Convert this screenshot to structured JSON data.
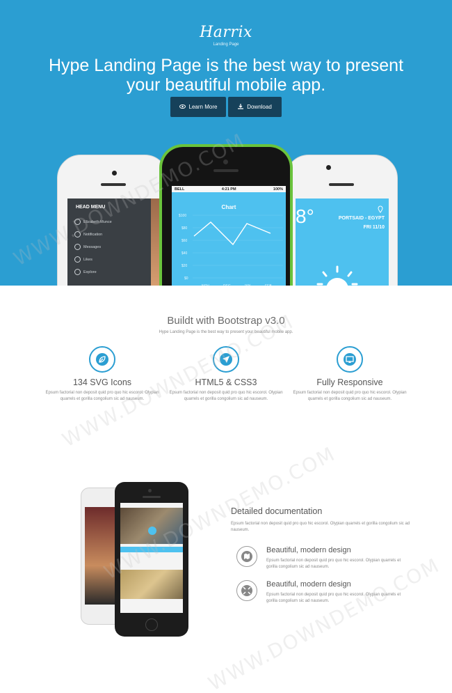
{
  "hero": {
    "logo": "Harrix",
    "logo_sub": "Landing Page",
    "title_line1": "Hype Landing Page is the best way to present",
    "title_line2": "your beautiful mobile app.",
    "learn_more": "Learn More",
    "download": "Download",
    "bg_color": "#2b9ed2",
    "button_color": "#16415a"
  },
  "phone_left": {
    "menu_title": "HEAD MENU",
    "items": [
      "Elizabeth Munce",
      "Notification",
      "Messages",
      "Likes",
      "Explore"
    ]
  },
  "phone_center": {
    "carrier": "BELL",
    "time": "4:21 PM",
    "battery": "100%",
    "chart_title": "Chart",
    "y_labels": [
      "$100",
      "$80",
      "$60",
      "$40",
      "$20",
      "$0"
    ],
    "x_labels": [
      "NOV",
      "DEC",
      "JAN",
      "FEB"
    ]
  },
  "phone_right": {
    "temp": "8°",
    "location": "PORTSAID - EGYPT",
    "date": "FRI  11/10"
  },
  "features": {
    "title": "Buildt with Bootstrap v3.0",
    "subtitle": "Hype Landing Page is the best way to present your beautiful mobile app.",
    "items": [
      {
        "title": "134 SVG Icons",
        "text": "Epsum factorial non deposit quid pro quo hic escorol. Olypian quarrels et gorilla congolium sic ad nauseum."
      },
      {
        "title": "HTML5 & CSS3",
        "text": "Epsum factorial non deposit quid pro quo hic escorol. Olypian quarrels et gorilla congolium sic ad nauseum."
      },
      {
        "title": "Fully Responsive",
        "text": "Epsum factorial non deposit quid pro quo hic escorol. Olypian quarrels et gorilla congolium sic ad nauseum."
      }
    ]
  },
  "docs": {
    "title": "Detailed documentation",
    "text": "Epsum factorial non deposit quid pro quo hic escorol. Olypian quarrels et gorilla congolium sic ad nauseum.",
    "items": [
      {
        "title": "Beautiful, modern design",
        "text": "Epsum factorial non deposit quid pro quo hic escorol. Olypian quarrels et gorilla congolium sic ad nauseum."
      },
      {
        "title": "Beautiful, modern design",
        "text": "Epsum factorial non deposit quid pro quo hic escorol. Olypian quarrels et gorilla congolium sic ad nauseum."
      }
    ]
  },
  "watermark": "WWW.DOWNDEMO.COM"
}
